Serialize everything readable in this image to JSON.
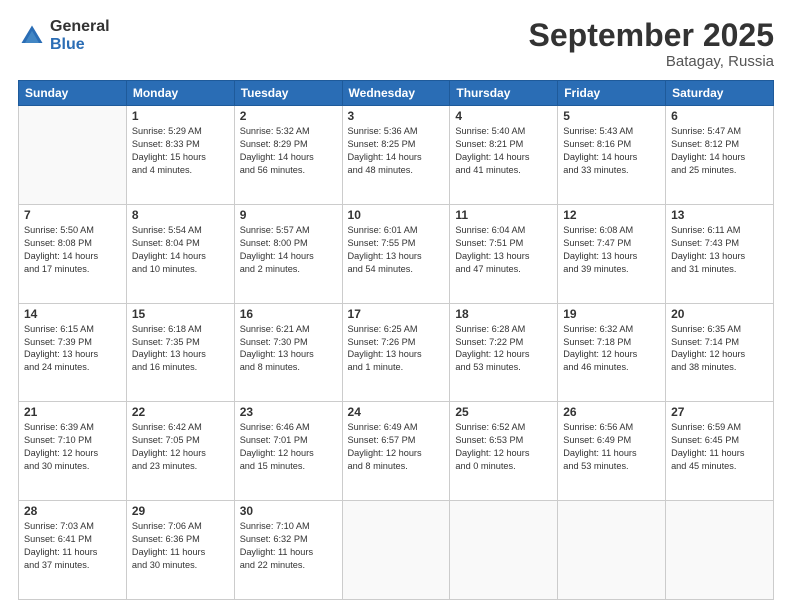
{
  "logo": {
    "general": "General",
    "blue": "Blue"
  },
  "title": "September 2025",
  "location": "Batagay, Russia",
  "weekdays": [
    "Sunday",
    "Monday",
    "Tuesday",
    "Wednesday",
    "Thursday",
    "Friday",
    "Saturday"
  ],
  "weeks": [
    [
      {
        "day": "",
        "info": ""
      },
      {
        "day": "1",
        "info": "Sunrise: 5:29 AM\nSunset: 8:33 PM\nDaylight: 15 hours\nand 4 minutes."
      },
      {
        "day": "2",
        "info": "Sunrise: 5:32 AM\nSunset: 8:29 PM\nDaylight: 14 hours\nand 56 minutes."
      },
      {
        "day": "3",
        "info": "Sunrise: 5:36 AM\nSunset: 8:25 PM\nDaylight: 14 hours\nand 48 minutes."
      },
      {
        "day": "4",
        "info": "Sunrise: 5:40 AM\nSunset: 8:21 PM\nDaylight: 14 hours\nand 41 minutes."
      },
      {
        "day": "5",
        "info": "Sunrise: 5:43 AM\nSunset: 8:16 PM\nDaylight: 14 hours\nand 33 minutes."
      },
      {
        "day": "6",
        "info": "Sunrise: 5:47 AM\nSunset: 8:12 PM\nDaylight: 14 hours\nand 25 minutes."
      }
    ],
    [
      {
        "day": "7",
        "info": "Sunrise: 5:50 AM\nSunset: 8:08 PM\nDaylight: 14 hours\nand 17 minutes."
      },
      {
        "day": "8",
        "info": "Sunrise: 5:54 AM\nSunset: 8:04 PM\nDaylight: 14 hours\nand 10 minutes."
      },
      {
        "day": "9",
        "info": "Sunrise: 5:57 AM\nSunset: 8:00 PM\nDaylight: 14 hours\nand 2 minutes."
      },
      {
        "day": "10",
        "info": "Sunrise: 6:01 AM\nSunset: 7:55 PM\nDaylight: 13 hours\nand 54 minutes."
      },
      {
        "day": "11",
        "info": "Sunrise: 6:04 AM\nSunset: 7:51 PM\nDaylight: 13 hours\nand 47 minutes."
      },
      {
        "day": "12",
        "info": "Sunrise: 6:08 AM\nSunset: 7:47 PM\nDaylight: 13 hours\nand 39 minutes."
      },
      {
        "day": "13",
        "info": "Sunrise: 6:11 AM\nSunset: 7:43 PM\nDaylight: 13 hours\nand 31 minutes."
      }
    ],
    [
      {
        "day": "14",
        "info": "Sunrise: 6:15 AM\nSunset: 7:39 PM\nDaylight: 13 hours\nand 24 minutes."
      },
      {
        "day": "15",
        "info": "Sunrise: 6:18 AM\nSunset: 7:35 PM\nDaylight: 13 hours\nand 16 minutes."
      },
      {
        "day": "16",
        "info": "Sunrise: 6:21 AM\nSunset: 7:30 PM\nDaylight: 13 hours\nand 8 minutes."
      },
      {
        "day": "17",
        "info": "Sunrise: 6:25 AM\nSunset: 7:26 PM\nDaylight: 13 hours\nand 1 minute."
      },
      {
        "day": "18",
        "info": "Sunrise: 6:28 AM\nSunset: 7:22 PM\nDaylight: 12 hours\nand 53 minutes."
      },
      {
        "day": "19",
        "info": "Sunrise: 6:32 AM\nSunset: 7:18 PM\nDaylight: 12 hours\nand 46 minutes."
      },
      {
        "day": "20",
        "info": "Sunrise: 6:35 AM\nSunset: 7:14 PM\nDaylight: 12 hours\nand 38 minutes."
      }
    ],
    [
      {
        "day": "21",
        "info": "Sunrise: 6:39 AM\nSunset: 7:10 PM\nDaylight: 12 hours\nand 30 minutes."
      },
      {
        "day": "22",
        "info": "Sunrise: 6:42 AM\nSunset: 7:05 PM\nDaylight: 12 hours\nand 23 minutes."
      },
      {
        "day": "23",
        "info": "Sunrise: 6:46 AM\nSunset: 7:01 PM\nDaylight: 12 hours\nand 15 minutes."
      },
      {
        "day": "24",
        "info": "Sunrise: 6:49 AM\nSunset: 6:57 PM\nDaylight: 12 hours\nand 8 minutes."
      },
      {
        "day": "25",
        "info": "Sunrise: 6:52 AM\nSunset: 6:53 PM\nDaylight: 12 hours\nand 0 minutes."
      },
      {
        "day": "26",
        "info": "Sunrise: 6:56 AM\nSunset: 6:49 PM\nDaylight: 11 hours\nand 53 minutes."
      },
      {
        "day": "27",
        "info": "Sunrise: 6:59 AM\nSunset: 6:45 PM\nDaylight: 11 hours\nand 45 minutes."
      }
    ],
    [
      {
        "day": "28",
        "info": "Sunrise: 7:03 AM\nSunset: 6:41 PM\nDaylight: 11 hours\nand 37 minutes."
      },
      {
        "day": "29",
        "info": "Sunrise: 7:06 AM\nSunset: 6:36 PM\nDaylight: 11 hours\nand 30 minutes."
      },
      {
        "day": "30",
        "info": "Sunrise: 7:10 AM\nSunset: 6:32 PM\nDaylight: 11 hours\nand 22 minutes."
      },
      {
        "day": "",
        "info": ""
      },
      {
        "day": "",
        "info": ""
      },
      {
        "day": "",
        "info": ""
      },
      {
        "day": "",
        "info": ""
      }
    ]
  ]
}
